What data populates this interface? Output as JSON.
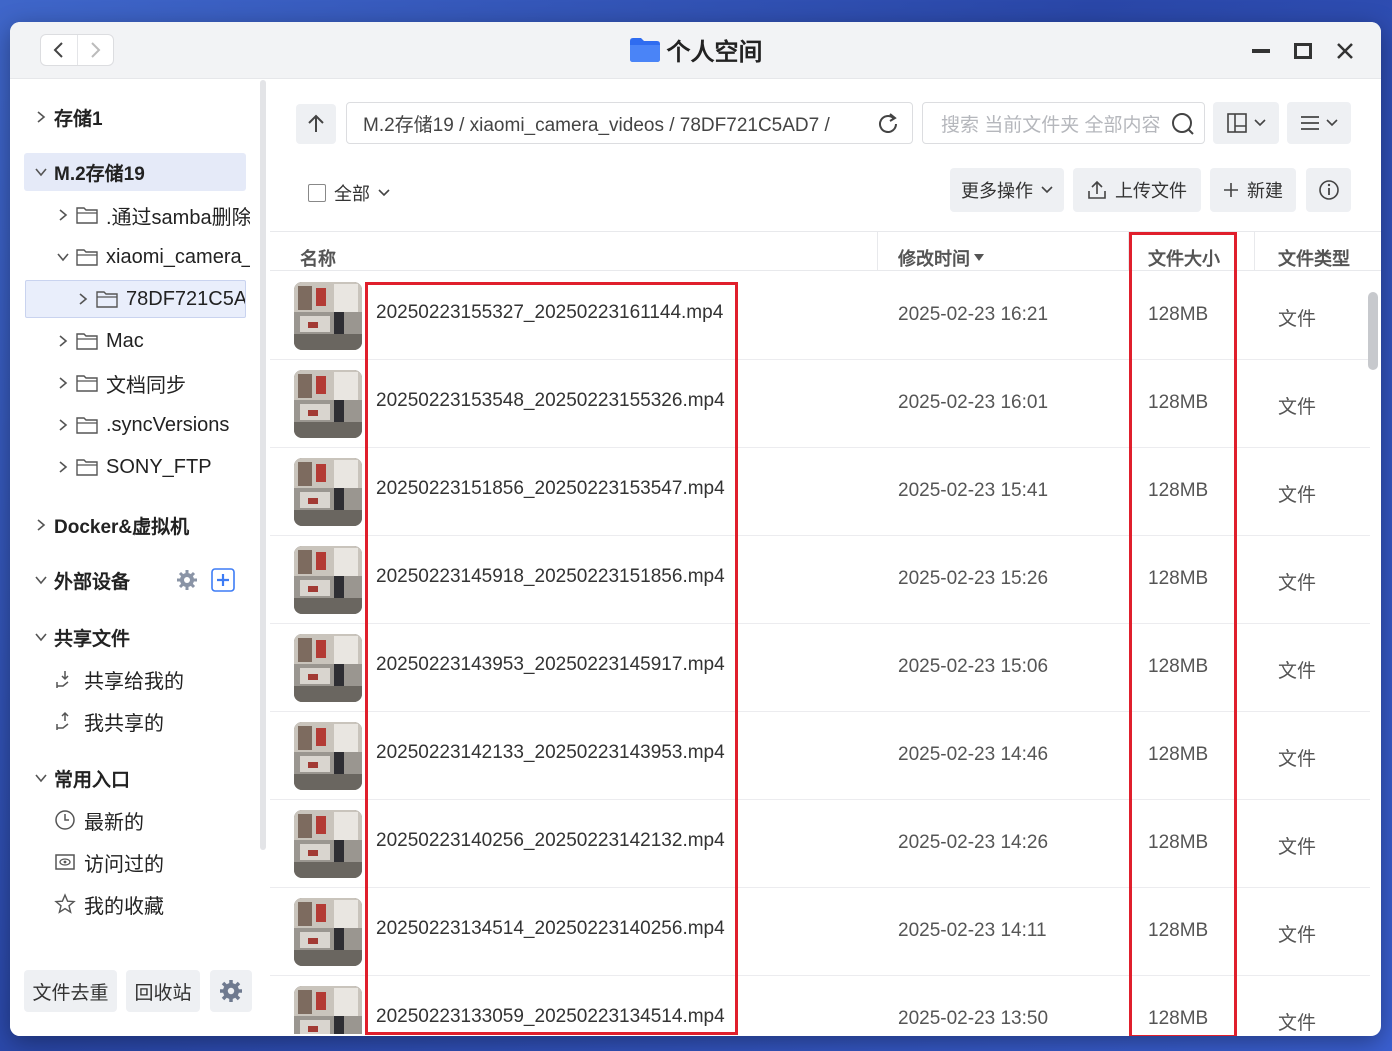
{
  "window": {
    "title": "个人空间",
    "accent": "#3d7cf5"
  },
  "sidebar": {
    "storage1": "存储1",
    "storage2": "M.2存储19",
    "folders": [
      {
        "label": ".通过samba删除",
        "expanded": false
      },
      {
        "label": "xiaomi_camera_",
        "expanded": true
      },
      {
        "label": "78DF721C5A",
        "expanded": false,
        "selected": true
      },
      {
        "label": "Mac",
        "expanded": false
      },
      {
        "label": "文档同步",
        "expanded": false
      },
      {
        "label": ".syncVersions",
        "expanded": false
      },
      {
        "label": "SONY_FTP",
        "expanded": false
      }
    ],
    "docker": "Docker&虚拟机",
    "external": "外部设备",
    "shared": "共享文件",
    "shared_items": [
      "共享给我的",
      "我共享的"
    ],
    "common": "常用入口",
    "common_items": [
      "最新的",
      "访问过的",
      "我的收藏"
    ],
    "bottom": {
      "dedupe": "文件去重",
      "recycle": "回收站"
    }
  },
  "toolbar": {
    "path": "M.2存储19 / xiaomi_camera_videos / 78DF721C5AD7 /",
    "search_placeholder": "搜索 当前文件夹 全部内容",
    "select_all": "全部",
    "more_ops": "更多操作",
    "upload": "上传文件",
    "new": "新建"
  },
  "columns": {
    "name": "名称",
    "modified": "修改时间",
    "size": "文件大小",
    "type": "文件类型"
  },
  "files": [
    {
      "name": "20250223155327_20250223161144.mp4",
      "time": "2025-02-23 16:21",
      "size": "128MB",
      "type": "文件"
    },
    {
      "name": "20250223153548_20250223155326.mp4",
      "time": "2025-02-23 16:01",
      "size": "128MB",
      "type": "文件"
    },
    {
      "name": "20250223151856_20250223153547.mp4",
      "time": "2025-02-23 15:41",
      "size": "128MB",
      "type": "文件"
    },
    {
      "name": "20250223145918_20250223151856.mp4",
      "time": "2025-02-23 15:26",
      "size": "128MB",
      "type": "文件"
    },
    {
      "name": "20250223143953_20250223145917.mp4",
      "time": "2025-02-23 15:06",
      "size": "128MB",
      "type": "文件"
    },
    {
      "name": "20250223142133_20250223143953.mp4",
      "time": "2025-02-23 14:46",
      "size": "128MB",
      "type": "文件"
    },
    {
      "name": "20250223140256_20250223142132.mp4",
      "time": "2025-02-23 14:26",
      "size": "128MB",
      "type": "文件"
    },
    {
      "name": "20250223134514_20250223140256.mp4",
      "time": "2025-02-23 14:11",
      "size": "128MB",
      "type": "文件"
    },
    {
      "name": "20250223133059_20250223134514.mp4",
      "time": "2025-02-23 13:50",
      "size": "128MB",
      "type": "文件"
    }
  ],
  "highlight_color": "#e01f2c"
}
